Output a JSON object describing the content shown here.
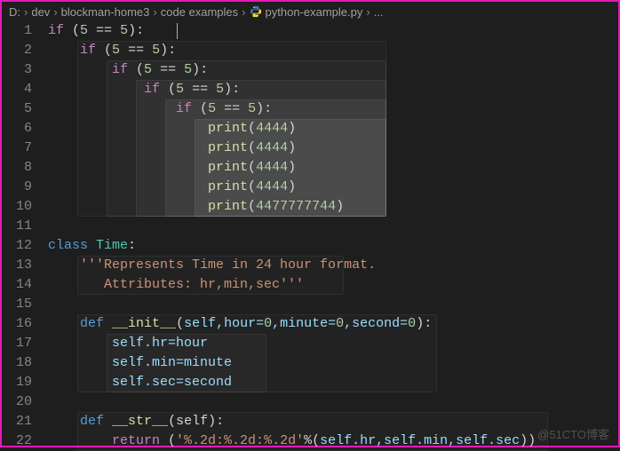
{
  "breadcrumb": {
    "items": [
      "D:",
      "dev",
      "blockman-home3",
      "code examples",
      "python-example.py",
      "..."
    ]
  },
  "gutter": {
    "lines": [
      "1",
      "2",
      "3",
      "4",
      "5",
      "6",
      "7",
      "8",
      "9",
      "10",
      "11",
      "12",
      "13",
      "14",
      "15",
      "16",
      "17",
      "18",
      "19",
      "20",
      "21",
      "22"
    ]
  },
  "code": {
    "kw_if": "if",
    "kw_class": "class",
    "kw_def": "def",
    "kw_return": "return",
    "cond_open": " (",
    "cond_n": "5",
    "cond_eq": " == ",
    "cond_close": "):",
    "print_fn": "print",
    "print_open": "(",
    "print_v1": "4444",
    "print_v2": "4477777744",
    "print_close": ")",
    "cls_name": "Time",
    "colon": ":",
    "doc1": "'''Represents Time in 24 hour format.",
    "doc2": "   Attributes: hr,min,sec'''",
    "init": "__init__",
    "init_params_open": "(",
    "init_self": "self",
    "init_p1": ",hour=",
    "init_p2": ",minute=",
    "init_p3": ",second=",
    "zero": "0",
    "init_params_close": "):",
    "a1": "self.hr=hour",
    "a2": "self.min=minute",
    "a3": "self.sec=second",
    "str_fn": "__str__",
    "str_params": "(self):",
    "ret_open": " (",
    "ret_fmt": "'%.2d:%.2d:%.2d'",
    "ret_mod": "%(",
    "ret_args": "self.hr,self.min,self.sec",
    "ret_close": "))"
  },
  "watermark": "@51CTO博客"
}
